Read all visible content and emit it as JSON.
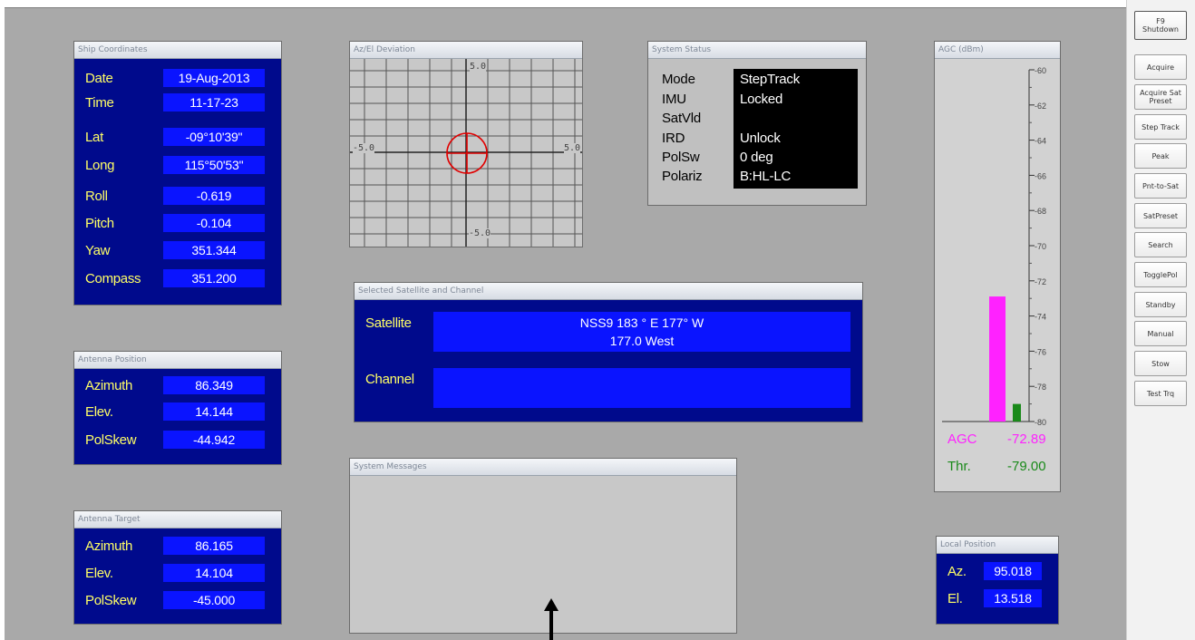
{
  "sidebar": {
    "buttons": [
      {
        "label": "F9 Shutdown"
      },
      {
        "label": "Acquire"
      },
      {
        "label": "Acquire Sat Preset"
      },
      {
        "label": "Step Track"
      },
      {
        "label": "Peak"
      },
      {
        "label": "Pnt-to-Sat"
      },
      {
        "label": "SatPreset"
      },
      {
        "label": "Search"
      },
      {
        "label": "TogglePol"
      },
      {
        "label": "Standby"
      },
      {
        "label": "Manual"
      },
      {
        "label": "Stow"
      },
      {
        "label": "Test Trq"
      }
    ]
  },
  "ship_coordinates": {
    "title": "Ship Coordinates",
    "rows": [
      {
        "label": "Date",
        "value": "19-Aug-2013"
      },
      {
        "label": "Time",
        "value": "11-17-23"
      },
      {
        "label": "Lat",
        "value": "-09°10'39\""
      },
      {
        "label": "Long",
        "value": "115°50'53\""
      },
      {
        "label": "Roll",
        "value": "-0.619"
      },
      {
        "label": "Pitch",
        "value": "-0.104"
      },
      {
        "label": "Yaw",
        "value": "351.344"
      },
      {
        "label": "Compass",
        "value": "351.200"
      }
    ]
  },
  "antenna_position": {
    "title": "Antenna Position",
    "rows": [
      {
        "label": "Azimuth",
        "value": "86.349"
      },
      {
        "label": "Elev.",
        "value": "14.144"
      },
      {
        "label": "PolSkew",
        "value": "-44.942"
      }
    ]
  },
  "antenna_target": {
    "title": "Antenna Target",
    "rows": [
      {
        "label": "Azimuth",
        "value": "86.165"
      },
      {
        "label": "Elev.",
        "value": "14.104"
      },
      {
        "label": "PolSkew",
        "value": "-45.000"
      }
    ]
  },
  "azel_deviation": {
    "title": "Az/El Deviation",
    "top_label": "5.0",
    "bottom_label": "-5.0",
    "left_label": "-5.0",
    "right_label": "5.0",
    "target_color": "#e00000"
  },
  "system_status": {
    "title": "System Status",
    "rows": [
      {
        "label": "Mode",
        "value": "StepTrack"
      },
      {
        "label": "IMU",
        "value": "Locked"
      },
      {
        "label": "SatVld",
        "value": ""
      },
      {
        "label": "IRD",
        "value": "Unlock"
      },
      {
        "label": "PolSw",
        "value": "0 deg"
      },
      {
        "label": "Polariz",
        "value": "B:HL-LC"
      }
    ]
  },
  "selected_satellite": {
    "title": "Selected Satellite and Channel",
    "satellite_label": "Satellite",
    "satellite_line1": "NSS9 183 ° E 177° W",
    "satellite_line2": "177.0 West",
    "channel_label": "Channel",
    "channel_value": ""
  },
  "system_messages": {
    "title": "System Messages"
  },
  "agc": {
    "title": "AGC (dBm)",
    "scale": [
      "-60",
      "-62",
      "-64",
      "-66",
      "-68",
      "-70",
      "-72",
      "-74",
      "-76",
      "-78",
      "-80"
    ],
    "agc_label": "AGC",
    "agc_value": "-72.89",
    "thr_label": "Thr.",
    "thr_value": "-79.00",
    "agc_level": -72.89,
    "thr_level": -79.0,
    "agc_color": "#ff22ff",
    "thr_color": "#1a8a1a"
  },
  "local_position": {
    "title": "Local Position",
    "rows": [
      {
        "label": "Az.",
        "value": "95.018"
      },
      {
        "label": "El.",
        "value": "13.518"
      }
    ]
  }
}
